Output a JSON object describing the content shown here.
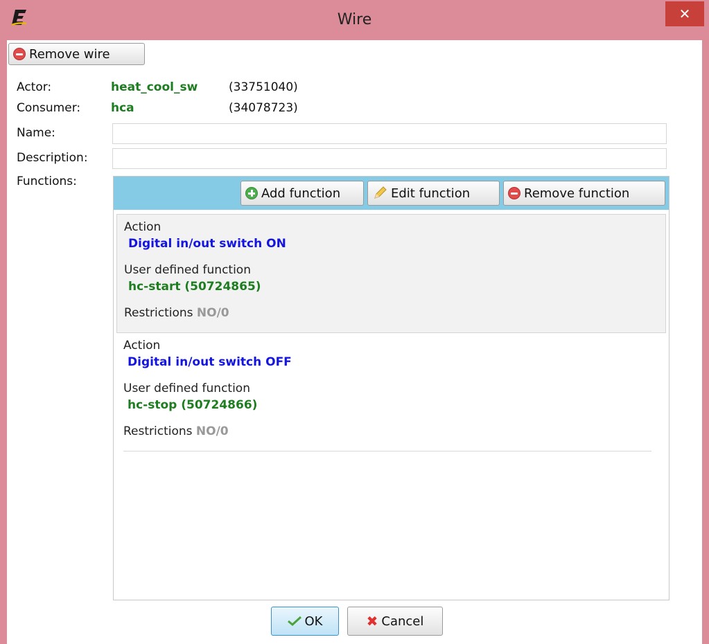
{
  "window": {
    "title": "Wire",
    "close_label": "✕"
  },
  "toolbar": {
    "remove_wire_label": "Remove wire"
  },
  "details": {
    "actor_label": "Actor:",
    "actor_name": "heat_cool_sw",
    "actor_id": "(33751040)",
    "consumer_label": "Consumer:",
    "consumer_name": "hca",
    "consumer_id": "(34078723)",
    "name_label": "Name:",
    "name_value": "",
    "description_label": "Description:",
    "description_value": "",
    "functions_label": "Functions:"
  },
  "functions_toolbar": {
    "add_label": "Add function",
    "edit_label": "Edit function",
    "remove_label": "Remove function"
  },
  "functions": [
    {
      "action_heading": "Action",
      "action": "Digital in/out switch ON",
      "udf_heading": "User defined function",
      "udf": "hc-start (50724865)",
      "restrictions_label": "Restrictions",
      "restrictions_value": "NO/0"
    },
    {
      "action_heading": "Action",
      "action": "Digital in/out switch OFF",
      "udf_heading": "User defined function",
      "udf": "hc-stop (50724866)",
      "restrictions_label": "Restrictions",
      "restrictions_value": "NO/0"
    }
  ],
  "footer": {
    "ok_label": "OK",
    "cancel_label": "Cancel"
  },
  "colors": {
    "titlebar": "#dc8c98",
    "close": "#c7413a",
    "functions_toolbar": "#86cbe6",
    "action_text": "#1515e0",
    "green_text": "#1e7d20"
  }
}
